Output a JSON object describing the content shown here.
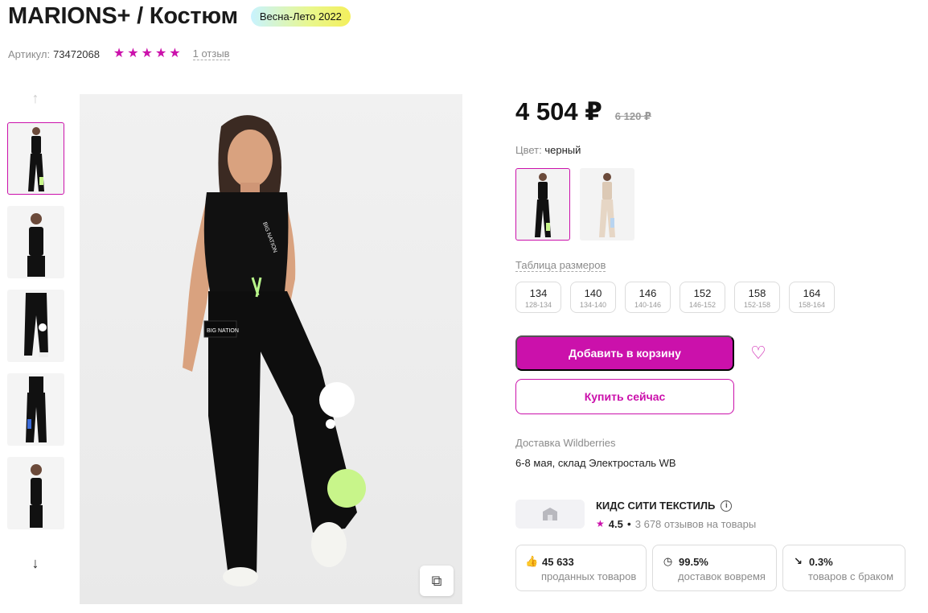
{
  "product": {
    "title": "MARIONS+ / Костюм",
    "season_badge": "Весна-Лето 2022",
    "article_label": "Артикул:",
    "article_value": "73472068",
    "rating_stars": 5,
    "reviews_link": "1 отзыв"
  },
  "price": {
    "current": "4 504 ₽",
    "old": "6 120 ₽"
  },
  "color": {
    "label": "Цвет:",
    "value": "черный",
    "options": [
      "черный",
      "бежевый"
    ]
  },
  "sizes": {
    "table_link": "Таблица размеров",
    "items": [
      {
        "main": "134",
        "sub": "128-134"
      },
      {
        "main": "140",
        "sub": "134-140"
      },
      {
        "main": "146",
        "sub": "140-146"
      },
      {
        "main": "152",
        "sub": "146-152"
      },
      {
        "main": "158",
        "sub": "152-158"
      },
      {
        "main": "164",
        "sub": "158-164"
      }
    ]
  },
  "actions": {
    "add_to_cart": "Добавить в корзину",
    "buy_now": "Купить сейчас"
  },
  "delivery": {
    "title": "Доставка Wildberries",
    "info": "6-8 мая, склад Электросталь WB"
  },
  "seller": {
    "name": "КИДС СИТИ ТЕКСТИЛЬ",
    "rating": "4.5",
    "reviews": "3 678 отзывов на товары"
  },
  "stats": [
    {
      "value": "45 633",
      "desc": "проданных товаров",
      "icon": "thumbs-up-icon"
    },
    {
      "value": "99.5%",
      "desc": "доставок вовремя",
      "icon": "clock-icon"
    },
    {
      "value": "0.3%",
      "desc": "товаров с браком",
      "icon": "trend-down-icon"
    }
  ],
  "colors": {
    "accent": "#cb11ab"
  }
}
